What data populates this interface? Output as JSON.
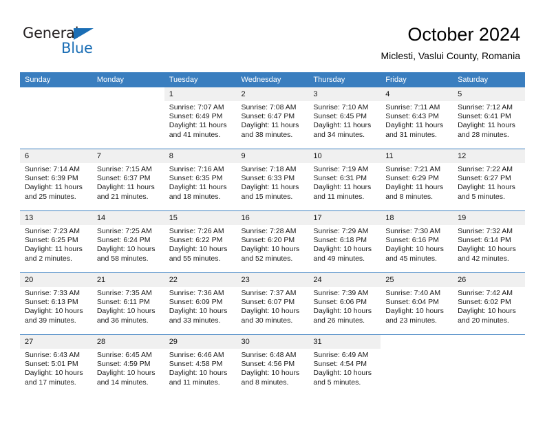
{
  "brand": {
    "word1": "General",
    "word2": "Blue",
    "accent": "#1a6eb5"
  },
  "header": {
    "title": "October 2024",
    "subtitle": "Miclesti, Vaslui County, Romania"
  },
  "theme": {
    "header_blue": "#3a7ebf",
    "daynum_band": "#f0f0f0"
  },
  "weekdays": [
    "Sunday",
    "Monday",
    "Tuesday",
    "Wednesday",
    "Thursday",
    "Friday",
    "Saturday"
  ],
  "weeks": [
    [
      {
        "day": "",
        "blank": true
      },
      {
        "day": "",
        "blank": true
      },
      {
        "day": "1",
        "sunrise": "Sunrise: 7:07 AM",
        "sunset": "Sunset: 6:49 PM",
        "daylight1": "Daylight: 11 hours",
        "daylight2": "and 41 minutes."
      },
      {
        "day": "2",
        "sunrise": "Sunrise: 7:08 AM",
        "sunset": "Sunset: 6:47 PM",
        "daylight1": "Daylight: 11 hours",
        "daylight2": "and 38 minutes."
      },
      {
        "day": "3",
        "sunrise": "Sunrise: 7:10 AM",
        "sunset": "Sunset: 6:45 PM",
        "daylight1": "Daylight: 11 hours",
        "daylight2": "and 34 minutes."
      },
      {
        "day": "4",
        "sunrise": "Sunrise: 7:11 AM",
        "sunset": "Sunset: 6:43 PM",
        "daylight1": "Daylight: 11 hours",
        "daylight2": "and 31 minutes."
      },
      {
        "day": "5",
        "sunrise": "Sunrise: 7:12 AM",
        "sunset": "Sunset: 6:41 PM",
        "daylight1": "Daylight: 11 hours",
        "daylight2": "and 28 minutes."
      }
    ],
    [
      {
        "day": "6",
        "sunrise": "Sunrise: 7:14 AM",
        "sunset": "Sunset: 6:39 PM",
        "daylight1": "Daylight: 11 hours",
        "daylight2": "and 25 minutes."
      },
      {
        "day": "7",
        "sunrise": "Sunrise: 7:15 AM",
        "sunset": "Sunset: 6:37 PM",
        "daylight1": "Daylight: 11 hours",
        "daylight2": "and 21 minutes."
      },
      {
        "day": "8",
        "sunrise": "Sunrise: 7:16 AM",
        "sunset": "Sunset: 6:35 PM",
        "daylight1": "Daylight: 11 hours",
        "daylight2": "and 18 minutes."
      },
      {
        "day": "9",
        "sunrise": "Sunrise: 7:18 AM",
        "sunset": "Sunset: 6:33 PM",
        "daylight1": "Daylight: 11 hours",
        "daylight2": "and 15 minutes."
      },
      {
        "day": "10",
        "sunrise": "Sunrise: 7:19 AM",
        "sunset": "Sunset: 6:31 PM",
        "daylight1": "Daylight: 11 hours",
        "daylight2": "and 11 minutes."
      },
      {
        "day": "11",
        "sunrise": "Sunrise: 7:21 AM",
        "sunset": "Sunset: 6:29 PM",
        "daylight1": "Daylight: 11 hours",
        "daylight2": "and 8 minutes."
      },
      {
        "day": "12",
        "sunrise": "Sunrise: 7:22 AM",
        "sunset": "Sunset: 6:27 PM",
        "daylight1": "Daylight: 11 hours",
        "daylight2": "and 5 minutes."
      }
    ],
    [
      {
        "day": "13",
        "sunrise": "Sunrise: 7:23 AM",
        "sunset": "Sunset: 6:25 PM",
        "daylight1": "Daylight: 11 hours",
        "daylight2": "and 2 minutes."
      },
      {
        "day": "14",
        "sunrise": "Sunrise: 7:25 AM",
        "sunset": "Sunset: 6:24 PM",
        "daylight1": "Daylight: 10 hours",
        "daylight2": "and 58 minutes."
      },
      {
        "day": "15",
        "sunrise": "Sunrise: 7:26 AM",
        "sunset": "Sunset: 6:22 PM",
        "daylight1": "Daylight: 10 hours",
        "daylight2": "and 55 minutes."
      },
      {
        "day": "16",
        "sunrise": "Sunrise: 7:28 AM",
        "sunset": "Sunset: 6:20 PM",
        "daylight1": "Daylight: 10 hours",
        "daylight2": "and 52 minutes."
      },
      {
        "day": "17",
        "sunrise": "Sunrise: 7:29 AM",
        "sunset": "Sunset: 6:18 PM",
        "daylight1": "Daylight: 10 hours",
        "daylight2": "and 49 minutes."
      },
      {
        "day": "18",
        "sunrise": "Sunrise: 7:30 AM",
        "sunset": "Sunset: 6:16 PM",
        "daylight1": "Daylight: 10 hours",
        "daylight2": "and 45 minutes."
      },
      {
        "day": "19",
        "sunrise": "Sunrise: 7:32 AM",
        "sunset": "Sunset: 6:14 PM",
        "daylight1": "Daylight: 10 hours",
        "daylight2": "and 42 minutes."
      }
    ],
    [
      {
        "day": "20",
        "sunrise": "Sunrise: 7:33 AM",
        "sunset": "Sunset: 6:13 PM",
        "daylight1": "Daylight: 10 hours",
        "daylight2": "and 39 minutes."
      },
      {
        "day": "21",
        "sunrise": "Sunrise: 7:35 AM",
        "sunset": "Sunset: 6:11 PM",
        "daylight1": "Daylight: 10 hours",
        "daylight2": "and 36 minutes."
      },
      {
        "day": "22",
        "sunrise": "Sunrise: 7:36 AM",
        "sunset": "Sunset: 6:09 PM",
        "daylight1": "Daylight: 10 hours",
        "daylight2": "and 33 minutes."
      },
      {
        "day": "23",
        "sunrise": "Sunrise: 7:37 AM",
        "sunset": "Sunset: 6:07 PM",
        "daylight1": "Daylight: 10 hours",
        "daylight2": "and 30 minutes."
      },
      {
        "day": "24",
        "sunrise": "Sunrise: 7:39 AM",
        "sunset": "Sunset: 6:06 PM",
        "daylight1": "Daylight: 10 hours",
        "daylight2": "and 26 minutes."
      },
      {
        "day": "25",
        "sunrise": "Sunrise: 7:40 AM",
        "sunset": "Sunset: 6:04 PM",
        "daylight1": "Daylight: 10 hours",
        "daylight2": "and 23 minutes."
      },
      {
        "day": "26",
        "sunrise": "Sunrise: 7:42 AM",
        "sunset": "Sunset: 6:02 PM",
        "daylight1": "Daylight: 10 hours",
        "daylight2": "and 20 minutes."
      }
    ],
    [
      {
        "day": "27",
        "sunrise": "Sunrise: 6:43 AM",
        "sunset": "Sunset: 5:01 PM",
        "daylight1": "Daylight: 10 hours",
        "daylight2": "and 17 minutes."
      },
      {
        "day": "28",
        "sunrise": "Sunrise: 6:45 AM",
        "sunset": "Sunset: 4:59 PM",
        "daylight1": "Daylight: 10 hours",
        "daylight2": "and 14 minutes."
      },
      {
        "day": "29",
        "sunrise": "Sunrise: 6:46 AM",
        "sunset": "Sunset: 4:58 PM",
        "daylight1": "Daylight: 10 hours",
        "daylight2": "and 11 minutes."
      },
      {
        "day": "30",
        "sunrise": "Sunrise: 6:48 AM",
        "sunset": "Sunset: 4:56 PM",
        "daylight1": "Daylight: 10 hours",
        "daylight2": "and 8 minutes."
      },
      {
        "day": "31",
        "sunrise": "Sunrise: 6:49 AM",
        "sunset": "Sunset: 4:54 PM",
        "daylight1": "Daylight: 10 hours",
        "daylight2": "and 5 minutes."
      },
      {
        "day": "",
        "blank": true
      },
      {
        "day": "",
        "blank": true
      }
    ]
  ]
}
